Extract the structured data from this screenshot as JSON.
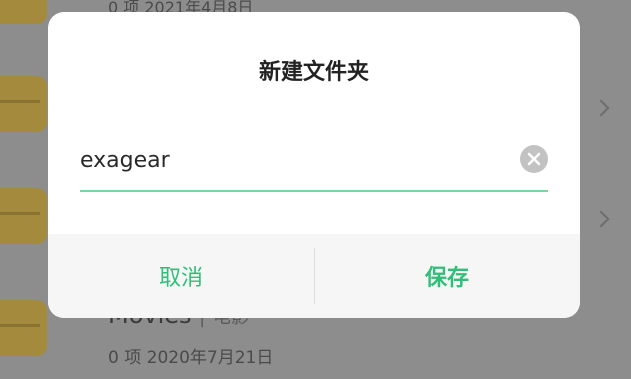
{
  "background": {
    "rows": [
      {
        "meta": "0 项  2021年4月8日"
      },
      {
        "title": "Movies",
        "subtitle": "电影",
        "meta": "0 项  2020年7月21日"
      }
    ]
  },
  "dialog": {
    "title": "新建文件夹",
    "input_value": "exagear",
    "cancel_label": "取消",
    "save_label": "保存"
  },
  "colors": {
    "accent": "#2fbf78",
    "underline": "#7cd3a6",
    "folder": "#a48a3d"
  }
}
